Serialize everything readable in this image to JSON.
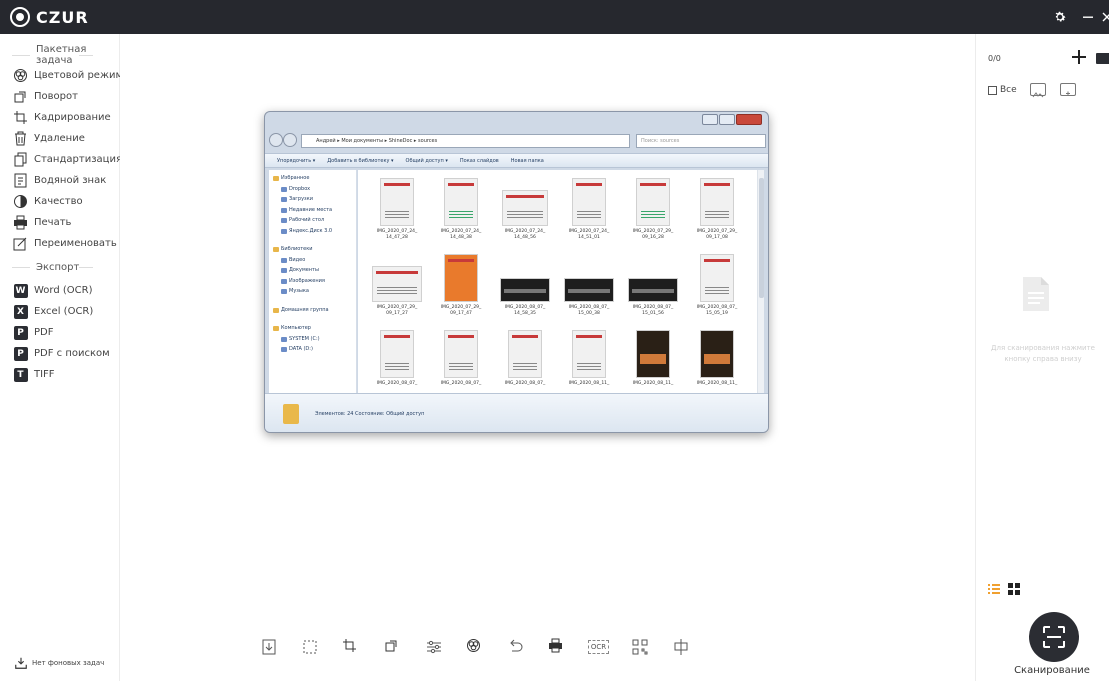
{
  "app": {
    "logo_text": "CZUR"
  },
  "sidebar": {
    "batch_title": "Пакетная задача",
    "batch_items": [
      {
        "label": "Цветовой режим",
        "icon": "color-mode-icon"
      },
      {
        "label": "Поворот",
        "icon": "rotate-icon"
      },
      {
        "label": "Кадрирование",
        "icon": "crop-icon"
      },
      {
        "label": "Удаление",
        "icon": "delete-icon"
      },
      {
        "label": "Стандартизация",
        "icon": "standardize-icon"
      },
      {
        "label": "Водяной знак",
        "icon": "watermark-icon"
      },
      {
        "label": "Качество",
        "icon": "quality-icon"
      },
      {
        "label": "Печать",
        "icon": "print-icon"
      },
      {
        "label": "Переименовать",
        "icon": "rename-icon"
      }
    ],
    "export_title": "Экспорт",
    "export_items": [
      {
        "label": "Word (OCR)",
        "badge": "W"
      },
      {
        "label": "Excel (OCR)",
        "badge": "X"
      },
      {
        "label": "PDF",
        "badge": "P"
      },
      {
        "label": "PDF с поиском",
        "badge": "P"
      },
      {
        "label": "TIFF",
        "badge": "T"
      }
    ],
    "background_tasks": "Нет фоновых задач"
  },
  "explorer": {
    "path": "Андрей ▸ Мои документы ▸ ShineDoc ▸ sources",
    "search_placeholder": "Поиск: sources",
    "toolbar": [
      "Упорядочить ▾",
      "Добавить в библиотеку ▾",
      "Общий доступ ▾",
      "Показ слайдов",
      "Новая папка"
    ],
    "nav": [
      "Избранное",
      "Dropbox",
      "Загрузки",
      "Недавние места",
      "Рабочий стол",
      "Яндекс.Диск 3.0",
      "",
      "Библиотеки",
      "Видео",
      "Документы",
      "Изображения",
      "Музыка",
      "",
      "Домашняя группа",
      "",
      "Компьютер",
      "SYSTEM (C:)",
      "DATA (D:)"
    ],
    "files": [
      {
        "name": "IMG_2020_07_24_ 14_47_28",
        "style": "doc"
      },
      {
        "name": "IMG_2020_07_24_ 14_48_38",
        "style": "green"
      },
      {
        "name": "IMG_2020_07_24_ 14_48_56",
        "style": "doc"
      },
      {
        "name": "IMG_2020_07_24_ 14_51_01",
        "style": "doc"
      },
      {
        "name": "IMG_2020_07_29_ 09_16_28",
        "style": "green"
      },
      {
        "name": "IMG_2020_07_29_ 09_17_08",
        "style": "doc"
      },
      {
        "name": "IMG_2020_07_29_ 09_17_27",
        "style": "doc"
      },
      {
        "name": "IMG_2020_07_29_ 09_17_47",
        "style": "orange"
      },
      {
        "name": "IMG_2020_08_07_ 14_58_35",
        "style": "dark"
      },
      {
        "name": "IMG_2020_08_07_ 15_00_38",
        "style": "dark"
      },
      {
        "name": "IMG_2020_08_07_ 15_01_56",
        "style": "dark"
      },
      {
        "name": "IMG_2020_08_07_ 15_05_19",
        "style": "doc"
      },
      {
        "name": "IMG_2020_08_07_",
        "style": "doc"
      },
      {
        "name": "IMG_2020_08_07_",
        "style": "doc"
      },
      {
        "name": "IMG_2020_08_07_",
        "style": "doc"
      },
      {
        "name": "IMG_2020_08_11_",
        "style": "doc"
      },
      {
        "name": "IMG_2020_08_11_",
        "style": "poster"
      },
      {
        "name": "IMG_2020_08_11_",
        "style": "poster"
      }
    ],
    "status": "Элементов: 24   Состояние: Общий доступ"
  },
  "bottom_toolbar": [
    "import-icon",
    "select-area-icon",
    "crop-icon",
    "rotate-icon",
    "adjust-icon",
    "color-mode-icon",
    "undo-icon",
    "print-icon",
    "ocr-icon",
    "qr-icon",
    "split-icon"
  ],
  "ocr_label": "OCR",
  "right_panel": {
    "counter": "0/0",
    "select_all": "Все",
    "empty_hint": "Для сканирования нажмите кнопку справа внизу",
    "scan_label": "Сканирование"
  }
}
